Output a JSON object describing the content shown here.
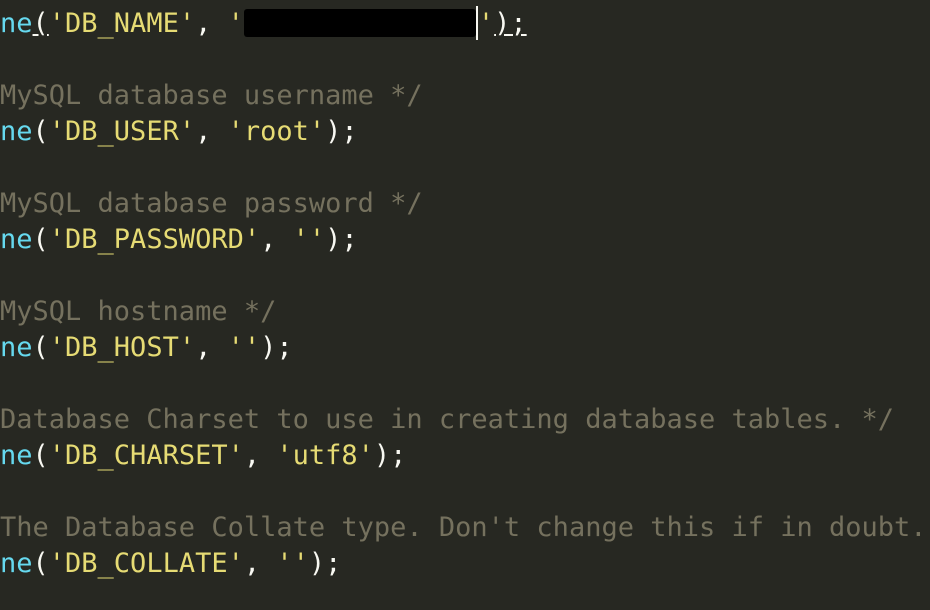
{
  "code": {
    "func_fragment": "ne",
    "open_paren": "(",
    "close": ");",
    "comma": ", ",
    "lines": {
      "db_name": {
        "key": "'DB_NAME'",
        "value_open": "'",
        "value_close": "'"
      },
      "c_user": "MySQL database username */",
      "db_user": {
        "key": "'DB_USER'",
        "value": "'root'"
      },
      "c_password": "MySQL database password */",
      "db_password": {
        "key": "'DB_PASSWORD'",
        "value": "''"
      },
      "c_host": "MySQL hostname */",
      "db_host": {
        "key": "'DB_HOST'",
        "value": "''"
      },
      "c_charset": "Database Charset to use in creating database tables. */",
      "db_charset": {
        "key": "'DB_CHARSET'",
        "value": "'utf8'"
      },
      "c_collate": "The Database Collate type. Don't change this if in doubt.",
      "db_collate": {
        "key": "'DB_COLLATE'",
        "value": "''"
      }
    }
  },
  "colors": {
    "background": "#272822",
    "function": "#66d9ef",
    "string": "#e6db74",
    "comment": "#75715e",
    "punctuation": "#f8f8f2"
  }
}
